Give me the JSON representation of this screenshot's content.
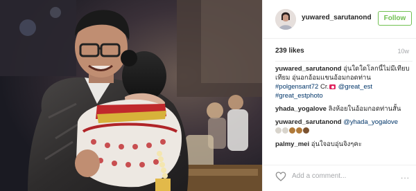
{
  "post": {
    "owner": "yuwared_sarutanond",
    "follow_label": "Follow",
    "likes": "239 likes",
    "time_ago": "10w"
  },
  "comments": [
    {
      "user": "yuwared_sarutanond",
      "text": "อุ่นใดใดโลกนี้ไม่มีเทียบเทียม อุ่นอกอ้อมแขนอ้อมกอดท่าน",
      "tag1": "#polgensant72",
      "cr": "Cr.",
      "mention": "@great_est",
      "tag2": "#great_estphoto"
    },
    {
      "user": "yhada_yogalove",
      "text": "ลิงห้อยในอ้อมกอดท่านสั้น"
    },
    {
      "user": "yuwared_sarutanond",
      "mention": "@yhada_yogalove"
    },
    {
      "user": "palmy_mei",
      "text": "อุ่นใจอบอุ่นจิงๆคะ"
    }
  ],
  "footer": {
    "add_comment_placeholder": "Add a comment...",
    "more_label": "..."
  },
  "icons": {
    "heart": "heart-outline-icon",
    "camera": "camera-emoji-icon",
    "more": "more-options-icon"
  },
  "colors": {
    "follow": "#70c050",
    "link": "#003569",
    "muted": "#a5a7aa",
    "border": "#efefef"
  }
}
